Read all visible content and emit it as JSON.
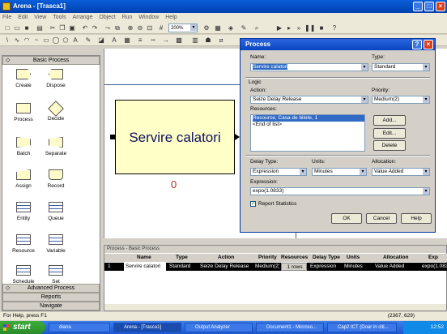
{
  "window": {
    "title": "Arena - [Trasca1]"
  },
  "menu": [
    "File",
    "Edit",
    "View",
    "Tools",
    "Arrange",
    "Object",
    "Run",
    "Window",
    "Help"
  ],
  "toolbar": {
    "zoom": "200%"
  },
  "panel": {
    "header": "Basic Process",
    "modules": [
      {
        "label": "Create",
        "icon": "create-shape-icon"
      },
      {
        "label": "Dispose",
        "icon": "dispose-shape-icon"
      },
      {
        "label": "Process",
        "icon": "process-shape-icon"
      },
      {
        "label": "Decide",
        "icon": "decide-diamond-icon"
      },
      {
        "label": "Batch",
        "icon": "batch-shape-icon"
      },
      {
        "label": "Separate",
        "icon": "separate-shape-icon"
      },
      {
        "label": "Assign",
        "icon": "assign-shape-icon"
      },
      {
        "label": "Record",
        "icon": "record-shape-icon"
      },
      {
        "label": "Entity",
        "icon": "spreadsheet-icon"
      },
      {
        "label": "Queue",
        "icon": "spreadsheet-icon"
      },
      {
        "label": "Resource",
        "icon": "spreadsheet-icon"
      },
      {
        "label": "Variable",
        "icon": "spreadsheet-icon"
      },
      {
        "label": "Schedule",
        "icon": "spreadsheet-icon"
      },
      {
        "label": "Set",
        "icon": "spreadsheet-icon"
      }
    ],
    "footers": [
      "Advanced Process",
      "Reports",
      "Navigate"
    ]
  },
  "canvas": {
    "block_label": "Servire calatori",
    "counter": "0"
  },
  "dialog": {
    "title": "Process",
    "name_label": "Name:",
    "name_value": "Servire calatori",
    "type_label": "Type:",
    "type_value": "Standard",
    "logic_label": "Logic",
    "action_label": "Action:",
    "action_value": "Seize Delay Release",
    "priority_label": "Priority:",
    "priority_value": "Medium(2)",
    "resources_label": "Resources:",
    "resources": [
      "Resource, Casa de bilete, 1",
      "<End of list>"
    ],
    "add_button": "Add...",
    "edit_button": "Edit...",
    "delete_button": "Delete",
    "delay_type_label": "Delay Type:",
    "delay_type_value": "Expression",
    "units_label": "Units:",
    "units_value": "Minutes",
    "allocation_label": "Allocation:",
    "allocation_value": "Value Added",
    "expression_label": "Expression:",
    "expression_value": "expo(1.0833)",
    "report_stats_label": "Report Statistics",
    "ok_button": "OK",
    "cancel_button": "Cancel",
    "help_button": "Help"
  },
  "sheet": {
    "caption": "Process - Basic Process",
    "columns": [
      "Name",
      "Type",
      "Action",
      "Priority",
      "Resources",
      "Delay Type",
      "Units",
      "Allocation",
      "Exp"
    ],
    "row": {
      "index": "1",
      "name": "Servire calatori",
      "type": "Standard",
      "action": "Seize Delay Release",
      "priority": "Medium(2)",
      "resources": "1 rows",
      "delay_type": "Expression",
      "units": "Minutes",
      "allocation": "Value Added",
      "expression": "expo(1.083"
    }
  },
  "status": {
    "help": "For Help, press F1",
    "coords": "(2367, 629)"
  },
  "taskbar": {
    "start": "start",
    "tasks": [
      "diana",
      "Arena - [Trasca1]",
      "Output Analyzer",
      "Document1 - Microso...",
      "Cap2 ICT (Doar in citi..."
    ],
    "clock": "12:52"
  }
}
